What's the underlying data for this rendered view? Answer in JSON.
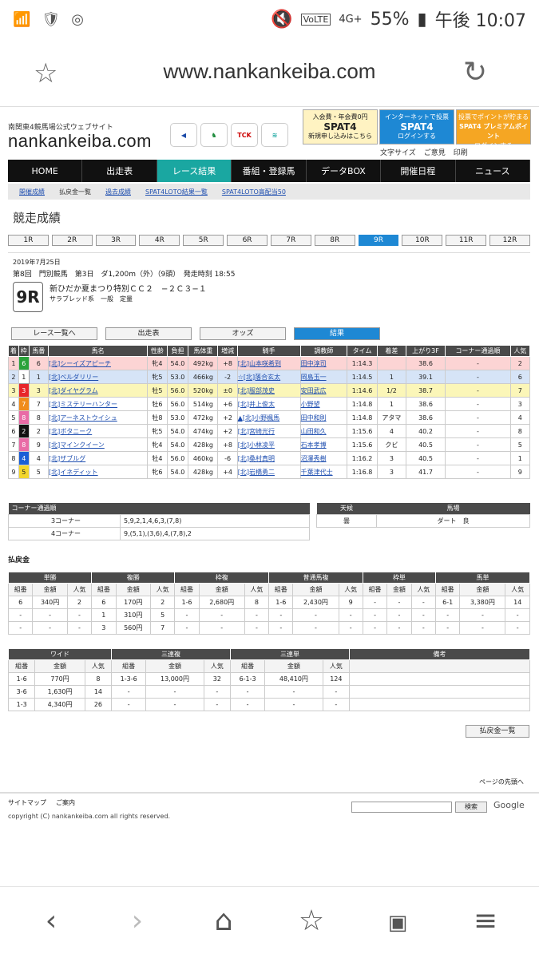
{
  "status": {
    "left_icons": [
      "wifi-calling-icon",
      "shield-icon",
      "voicemail-icon"
    ],
    "right": "55%",
    "time": "午後 10:07",
    "signal_text": "4G+",
    "volte": "VoLTE"
  },
  "browser": {
    "url": "www.nankankeiba.com"
  },
  "site": {
    "header_small": "南関東4競馬場公式ウェブサイト",
    "logo": "nankankeiba.com",
    "marks": [
      "TCK",
      "",
      "",
      ""
    ],
    "ads": [
      {
        "title": "入会費・年会費0円",
        "name": "SPAT4",
        "sub": "新規申し込みはこちら"
      },
      {
        "title": "インターネットで投票",
        "name": "SPAT4",
        "sub": "ログインする"
      },
      {
        "title": "投票でポイントが貯まる",
        "name": "SPAT4 プレミアムポイント",
        "sub": "ログインする"
      }
    ],
    "tools": [
      "文字サイズ",
      "ご意見",
      "印刷"
    ],
    "nav": [
      "HOME",
      "出走表",
      "レース結果",
      "番組・登録馬",
      "データBOX",
      "開催日程",
      "ニュース"
    ],
    "subnav": [
      "開催成績",
      "払戻金一覧",
      "過去成績",
      "SPAT4LOTO結果一覧",
      "SPAT4LOTO高配当50"
    ],
    "page_title": "競走成績",
    "race_tabs": [
      "1R",
      "2R",
      "3R",
      "4R",
      "5R",
      "6R",
      "7R",
      "8R",
      "9R",
      "10R",
      "11R",
      "12R"
    ],
    "info": {
      "date": "2019年7月25日",
      "line1": "第8回　門別競馬　第3日　ダ1,200m（外）（9頭）　発走時刻 18:55",
      "race_no": "9R",
      "race_name": "新ひだか夏まつり特別ＣＣ２　−２Ｃ３−１",
      "sub": "サラブレッド系　一般　定量"
    },
    "buttons": [
      "レース一覧へ",
      "出走表",
      "オッズ",
      "結果"
    ],
    "result_headers": [
      "着",
      "枠",
      "馬番",
      "馬名",
      "性齢",
      "負担",
      "馬体重",
      "増減",
      "騎手",
      "調教師",
      "タイム",
      "着差",
      "上がり3F",
      "コーナー通過順",
      "人気"
    ],
    "results": [
      [
        "1",
        "6",
        "6",
        "[北]シーイズアピーチ",
        "牝4",
        "54.0",
        "492kg",
        "+8",
        "[北]山本咲希到",
        "田中淳司",
        "1:14.3",
        "",
        "38.6",
        "-",
        "2"
      ],
      [
        "2",
        "1",
        "1",
        "[北]ベルダリリー",
        "牝5",
        "53.0",
        "466kg",
        "-2",
        "☆[北]落合玄太",
        "岡島玉一",
        "1:14.5",
        "1",
        "39.1",
        "-",
        "6"
      ],
      [
        "3",
        "3",
        "3",
        "[北]ダイヤグラム",
        "牡5",
        "56.0",
        "520kg",
        "±0",
        "[北]服部茂史",
        "安田武広",
        "1:14.6",
        "1/2",
        "38.7",
        "-",
        "7"
      ],
      [
        "4",
        "7",
        "7",
        "[北]ミステリーハンター",
        "牡6",
        "56.0",
        "514kg",
        "+6",
        "[北]井上俊太",
        "小野望",
        "1:14.8",
        "1",
        "38.6",
        "-",
        "3"
      ],
      [
        "5",
        "8",
        "8",
        "[北]アーネストウイシュ",
        "牡8",
        "53.0",
        "472kg",
        "+2",
        "▲[北]小野楓馬",
        "田中和則",
        "1:14.8",
        "アタマ",
        "38.6",
        "-",
        "4"
      ],
      [
        "6",
        "2",
        "2",
        "[北]ボタニーク",
        "牝5",
        "54.0",
        "474kg",
        "+2",
        "[北]宮崎光行",
        "山田和久",
        "1:15.6",
        "4",
        "40.2",
        "-",
        "8"
      ],
      [
        "7",
        "8",
        "9",
        "[北]マインクイーン",
        "牝4",
        "54.0",
        "428kg",
        "+8",
        "[北]小林凌平",
        "石本孝博",
        "1:15.6",
        "クビ",
        "40.5",
        "-",
        "5"
      ],
      [
        "8",
        "4",
        "4",
        "[北]ザブルグ",
        "牡4",
        "56.0",
        "460kg",
        "-6",
        "[北]桑村真明",
        "沼澤秀樹",
        "1:16.2",
        "3",
        "40.5",
        "-",
        "1"
      ],
      [
        "9",
        "5",
        "5",
        "[北]イネディット",
        "牝6",
        "54.0",
        "428kg",
        "+4",
        "[北]岩橋勇二",
        "千葉津代士",
        "1:16.8",
        "3",
        "41.7",
        "-",
        "9"
      ]
    ],
    "corner": {
      "title": "コーナー通過順",
      "rows": [
        [
          "3コーナー",
          "5,9,2,1,4,6,3,(7,8)"
        ],
        [
          "4コーナー",
          "9,(5,1),(3,6),4,(7,8),2"
        ]
      ]
    },
    "weather": {
      "headers": [
        "天候",
        "馬場"
      ],
      "values": [
        "曇",
        "ダート　良"
      ]
    },
    "payout_label": "払戻金",
    "payout1": {
      "groups": [
        "単勝",
        "複勝",
        "枠複",
        "普通馬複",
        "枠単",
        "馬単"
      ],
      "sub": [
        "組番",
        "金額",
        "人気"
      ],
      "rows": [
        [
          "6",
          "340円",
          "2",
          "6",
          "170円",
          "2",
          "1-6",
          "2,680円",
          "8",
          "1-6",
          "2,430円",
          "9",
          "-",
          "-",
          "-",
          "6-1",
          "3,380円",
          "14"
        ],
        [
          "-",
          "-",
          "-",
          "1",
          "310円",
          "5",
          "-",
          "-",
          "-",
          "-",
          "-",
          "-",
          "-",
          "-",
          "-",
          "-",
          "-",
          "-"
        ],
        [
          "-",
          "-",
          "-",
          "3",
          "560円",
          "7",
          "-",
          "-",
          "-",
          "-",
          "-",
          "-",
          "-",
          "-",
          "-",
          "-",
          "-",
          "-"
        ]
      ]
    },
    "payout2": {
      "groups": [
        "ワイド",
        "三連複",
        "三連単",
        "備考"
      ],
      "sub": [
        "組番",
        "金額",
        "人気"
      ],
      "rows": [
        [
          "1-6",
          "770円",
          "8",
          "1-3-6",
          "13,000円",
          "32",
          "6-1-3",
          "48,410円",
          "124"
        ],
        [
          "3-6",
          "1,630円",
          "14",
          "-",
          "-",
          "-",
          "-",
          "-",
          "-"
        ],
        [
          "1-3",
          "4,340円",
          "26",
          "-",
          "-",
          "-",
          "-",
          "-",
          "-"
        ]
      ]
    },
    "payout_button": "払戻金一覧",
    "page_top": "ページの先頭へ",
    "footer": {
      "links": [
        "サイトマップ",
        "ご案内"
      ],
      "copyright": "copyright (C) nankankeiba.com all rights reserved.",
      "search_button": "検索",
      "google": "Google"
    }
  },
  "colors": {
    "nav_active": "#1aa7a1",
    "race_tab_active": "#1e88d4",
    "frame": [
      "#ffffff",
      "#111111",
      "#e8262a",
      "#1a5fd6",
      "#f3d62b",
      "#2aa23a",
      "#f08c1c",
      "#e96ba6"
    ]
  }
}
